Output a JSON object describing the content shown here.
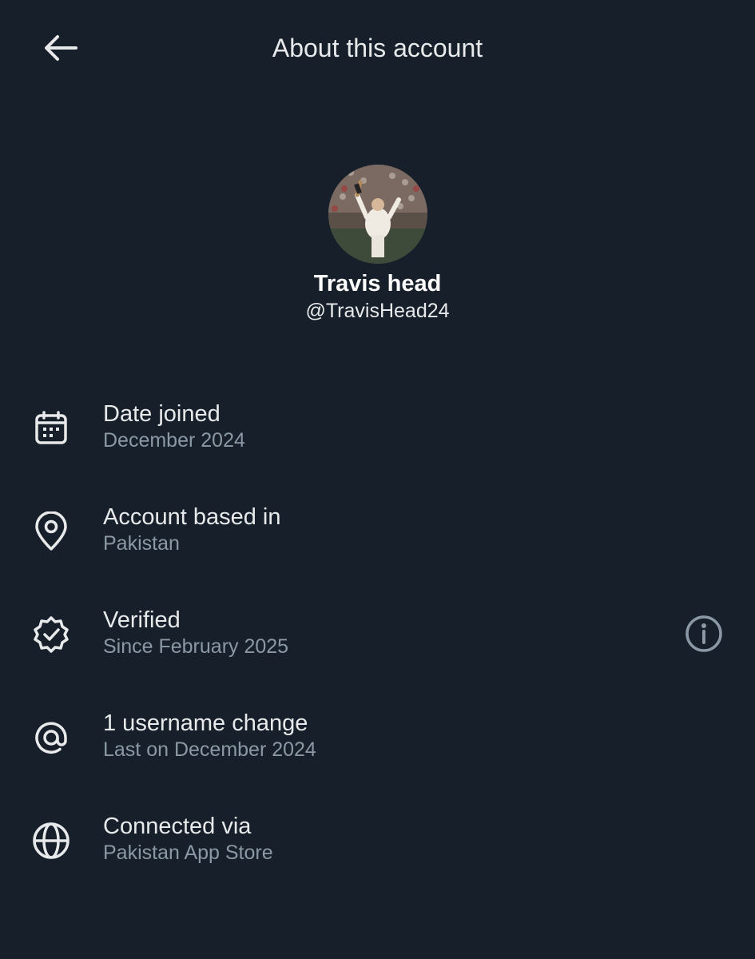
{
  "header": {
    "title": "About this account",
    "back_icon": "arrow-left-icon"
  },
  "profile": {
    "display_name": "Travis head",
    "handle": "@TravisHead24",
    "avatar": "avatar-photo"
  },
  "rows": [
    {
      "icon": "calendar-icon",
      "title": "Date joined",
      "subtitle": "December 2024"
    },
    {
      "icon": "location-pin-icon",
      "title": "Account based in",
      "subtitle": "Pakistan"
    },
    {
      "icon": "verified-badge-icon",
      "title": "Verified",
      "subtitle": "Since February 2025",
      "action_icon": "info-icon"
    },
    {
      "icon": "at-sign-icon",
      "title": "1 username change",
      "subtitle": "Last on December 2024"
    },
    {
      "icon": "globe-icon",
      "title": "Connected via",
      "subtitle": "Pakistan App Store"
    }
  ],
  "colors": {
    "background": "#17202a",
    "primary_text": "#e7e9ea",
    "secondary_text": "#8b98a5"
  }
}
